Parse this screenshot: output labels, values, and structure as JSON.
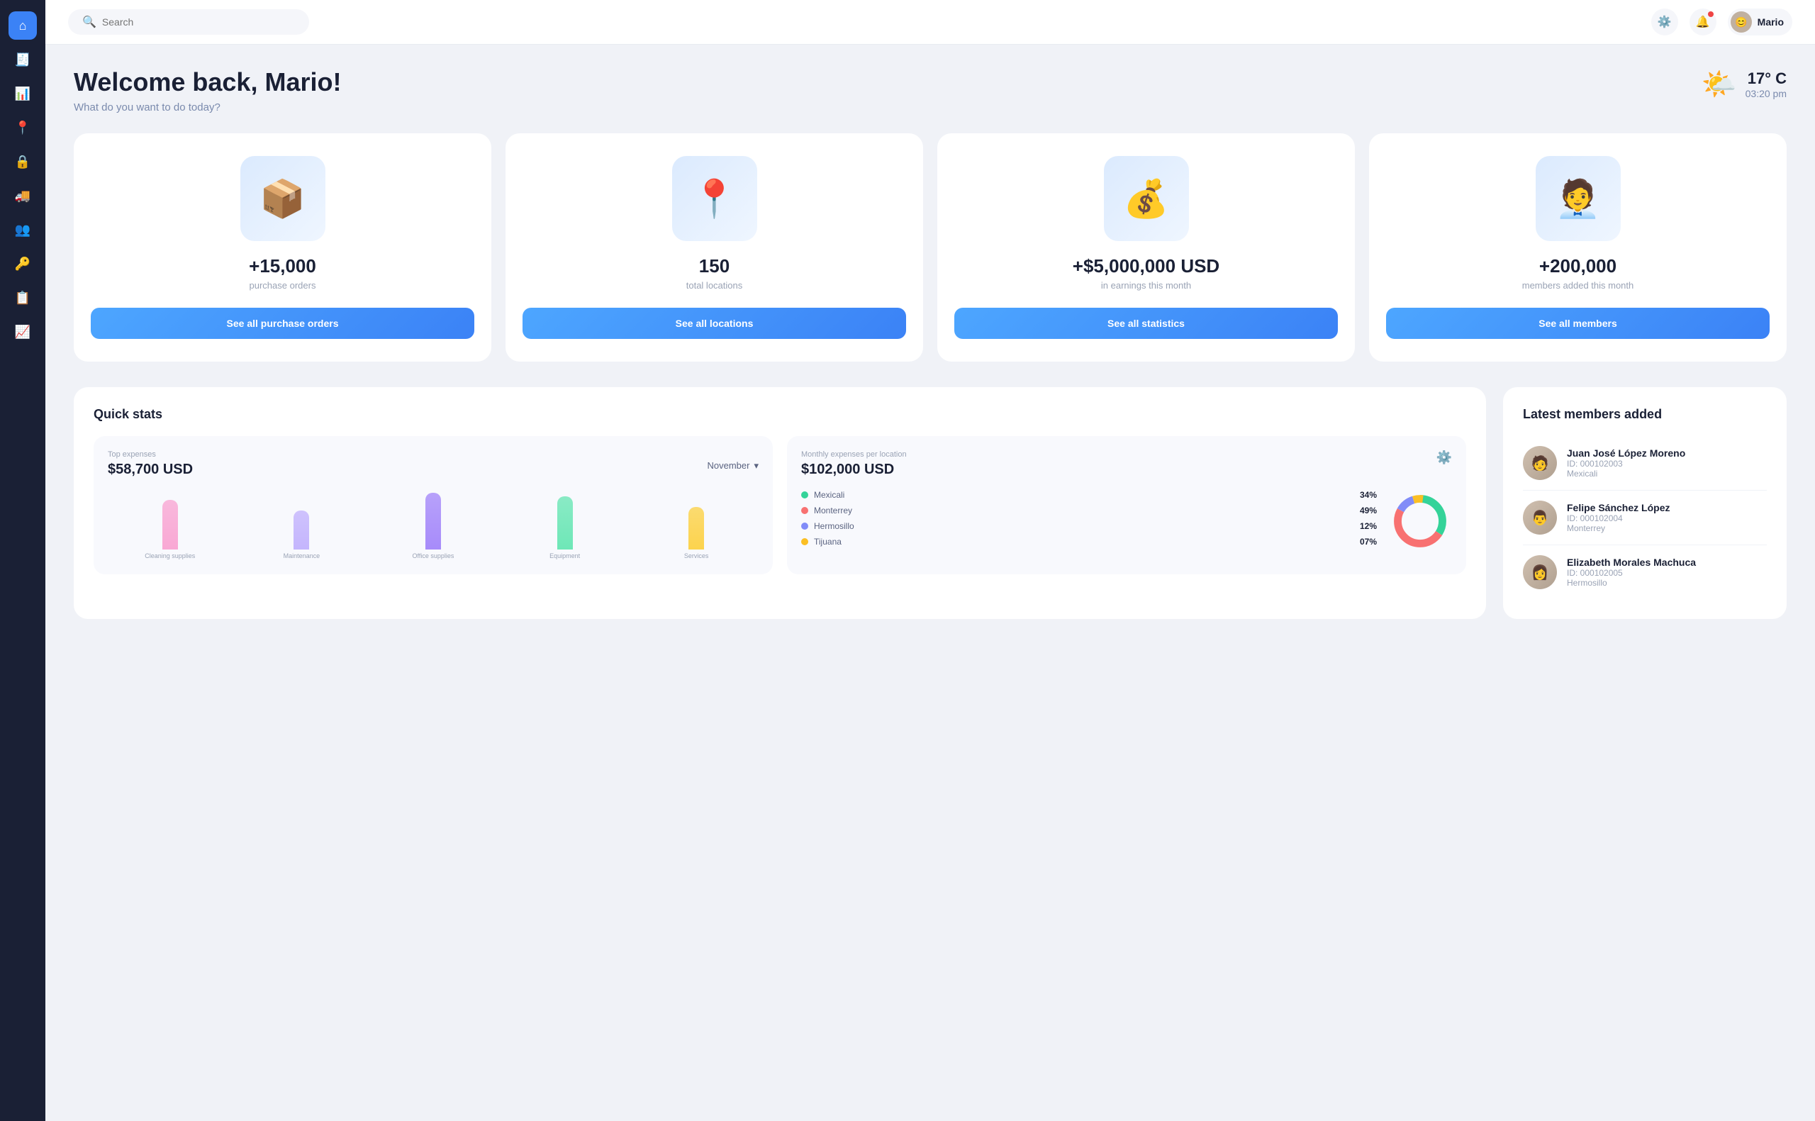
{
  "sidebar": {
    "items": [
      {
        "id": "home",
        "icon": "⌂",
        "active": true
      },
      {
        "id": "orders",
        "icon": "🧾",
        "active": false
      },
      {
        "id": "dashboard",
        "icon": "📊",
        "active": false
      },
      {
        "id": "location",
        "icon": "📍",
        "active": false
      },
      {
        "id": "lock",
        "icon": "🔒",
        "active": false
      },
      {
        "id": "truck",
        "icon": "🚚",
        "active": false
      },
      {
        "id": "people",
        "icon": "👥",
        "active": false
      },
      {
        "id": "key",
        "icon": "🔑",
        "active": false
      },
      {
        "id": "table",
        "icon": "📋",
        "active": false
      },
      {
        "id": "chart",
        "icon": "📈",
        "active": false
      }
    ]
  },
  "topbar": {
    "search_placeholder": "Search",
    "user_name": "Mario",
    "settings_label": "settings",
    "notifications_label": "notifications"
  },
  "welcome": {
    "title": "Welcome back, Mario!",
    "subtitle": "What do you want to do today?",
    "weather_temp": "17° C",
    "weather_time": "03:20 pm"
  },
  "stat_cards": [
    {
      "id": "purchase-orders",
      "icon": "📦",
      "value": "+15,000",
      "label": "purchase orders",
      "btn_label": "See all purchase orders"
    },
    {
      "id": "locations",
      "icon": "📍",
      "value": "150",
      "label": "total locations",
      "btn_label": "See all locations"
    },
    {
      "id": "statistics",
      "icon": "💰",
      "value": "+$5,000,000 USD",
      "label": "in earnings this month",
      "btn_label": "See all statistics"
    },
    {
      "id": "members",
      "icon": "👤",
      "value": "+200,000",
      "label": "members added this month",
      "btn_label": "See all members"
    }
  ],
  "quick_stats": {
    "title": "Quick stats",
    "top_expenses": {
      "label": "Top expenses",
      "value": "$58,700 USD",
      "month": "November",
      "bars": [
        {
          "label": "Cleaning\nsupplies",
          "height": 70,
          "color": "#f9a8d4"
        },
        {
          "label": "Maintenance",
          "height": 55,
          "color": "#c4b5fd"
        },
        {
          "label": "Office\nsupplies",
          "height": 80,
          "color": "#a78bfa"
        },
        {
          "label": "Equipment",
          "height": 75,
          "color": "#6ee7b7"
        },
        {
          "label": "Services",
          "height": 60,
          "color": "#fcd34d"
        }
      ]
    },
    "monthly_expenses": {
      "label": "Monthly expenses per location",
      "value": "$102,000 USD",
      "locations": [
        {
          "name": "Mexicali",
          "pct": "34%",
          "color": "#34d399"
        },
        {
          "name": "Monterrey",
          "pct": "49%",
          "color": "#f87171"
        },
        {
          "name": "Hermosillo",
          "pct": "12%",
          "color": "#818cf8"
        },
        {
          "name": "Tijuana",
          "pct": "07%",
          "color": "#fbbf24"
        }
      ]
    }
  },
  "latest_members": {
    "title": "Latest members added",
    "members": [
      {
        "name": "Juan José López Moreno",
        "id": "ID: 000102003",
        "location": "Mexicali",
        "emoji": "🧑"
      },
      {
        "name": "Felipe Sánchez López",
        "id": "ID: 000102004",
        "location": "Monterrey",
        "emoji": "👨"
      },
      {
        "name": "Elizabeth Morales Machuca",
        "id": "ID: 000102005",
        "location": "Hermosillo",
        "emoji": "👩"
      }
    ]
  }
}
